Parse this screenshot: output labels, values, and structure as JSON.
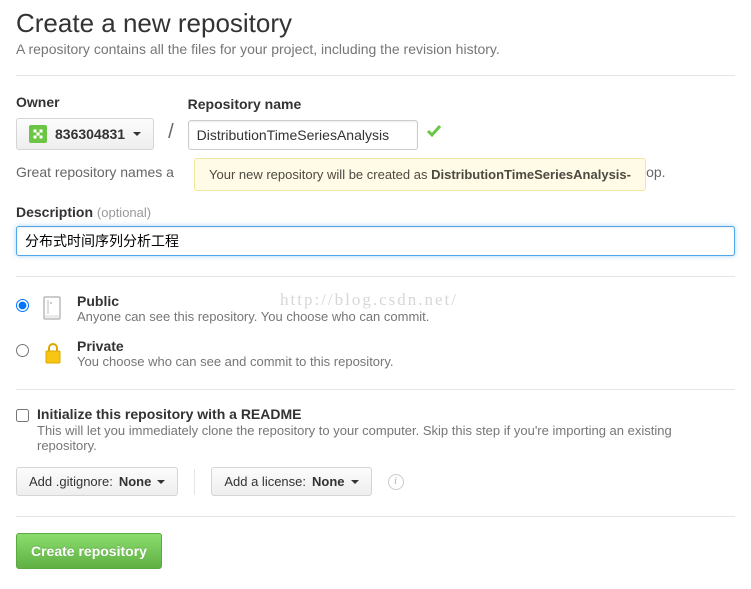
{
  "header": {
    "title": "Create a new repository",
    "subhead": "A repository contains all the files for your project, including the revision history."
  },
  "owner": {
    "label": "Owner",
    "username": "836304831"
  },
  "reponame": {
    "label": "Repository name",
    "value": "DistributionTimeSeriesAnalysis"
  },
  "tooltip": {
    "prefix": "Your new repository will be created as ",
    "name": "DistributionTimeSeriesAnalysis-"
  },
  "suggestion": {
    "visible_fragment_left": "Great repository names a",
    "visible_fragment_right": "llop."
  },
  "description": {
    "label": "Description",
    "optional": "(optional)",
    "value": "分布式时间序列分析工程"
  },
  "watermark": "http://blog.csdn.net/",
  "visibility": {
    "public": {
      "title": "Public",
      "desc": "Anyone can see this repository. You choose who can commit.",
      "checked": true
    },
    "private": {
      "title": "Private",
      "desc": "You choose who can see and commit to this repository.",
      "checked": false
    }
  },
  "readme": {
    "title": "Initialize this repository with a README",
    "desc": "This will let you immediately clone the repository to your computer. Skip this step if you're importing an existing repository.",
    "checked": false
  },
  "selectors": {
    "gitignore": {
      "prefix": "Add .gitignore: ",
      "value": "None"
    },
    "license": {
      "prefix": "Add a license: ",
      "value": "None"
    }
  },
  "submit": {
    "label": "Create repository"
  }
}
